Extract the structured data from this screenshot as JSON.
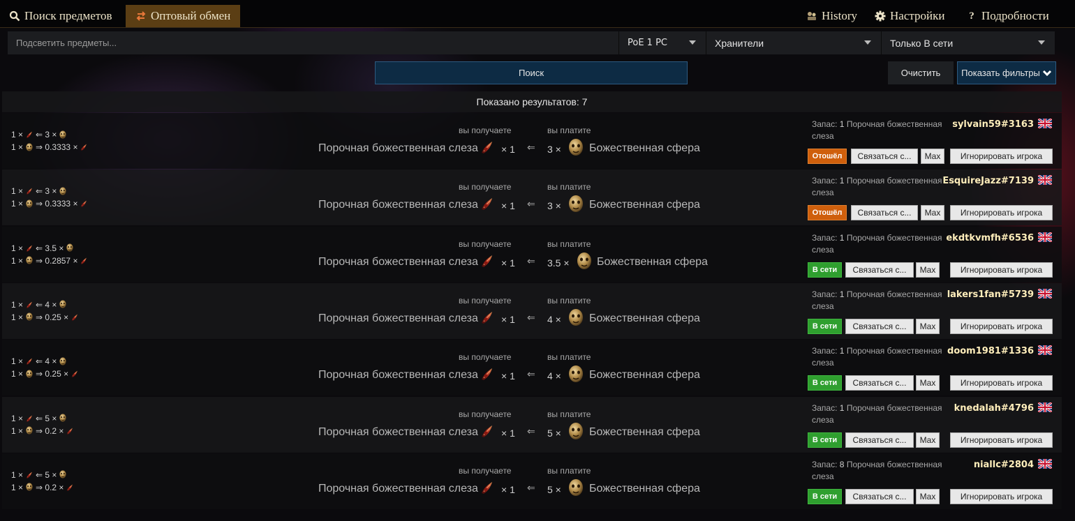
{
  "nav": {
    "search_items": "Поиск предметов",
    "bulk_exchange": "Оптовый обмен",
    "history": "History",
    "settings": "Настройки",
    "about": "Подробности"
  },
  "filters": {
    "highlight_placeholder": "Подсветить предметы...",
    "league": "PoE 1 PC",
    "league_mode": "Хранители",
    "status": "Только В сети"
  },
  "buttons": {
    "search": "Поиск",
    "clear": "Очистить",
    "show_filters": "Показать фильтры"
  },
  "results_label": "Показано результатов:",
  "results_count": "7",
  "labels": {
    "you_get": "вы получаете",
    "you_pay": "вы платите",
    "get_item": "Порочная божественная слеза",
    "pay_item": "Божественная сфера",
    "stock_prefix": "Запас:",
    "contact": "Связаться с...",
    "max": "Max",
    "ignore": "Игнорировать игрока"
  },
  "rows": [
    {
      "ratio1": "1 × ",
      "ratio1b": " ⇐ 3 × ",
      "ratio2": "1 × ",
      "ratio2b": " ⇒ 0.3333 × ",
      "get_qty": "× 1",
      "pay_qty": "3 ×",
      "stock": "1",
      "account": "sylvain59#3163",
      "status": "Отошёл",
      "online": false
    },
    {
      "ratio1": "1 × ",
      "ratio1b": " ⇐ 3 × ",
      "ratio2": "1 × ",
      "ratio2b": " ⇒ 0.3333 × ",
      "get_qty": "× 1",
      "pay_qty": "3 ×",
      "stock": "1",
      "account": "EsquireJazz#7139",
      "status": "Отошёл",
      "online": false
    },
    {
      "ratio1": "1 × ",
      "ratio1b": " ⇐ 3.5 × ",
      "ratio2": "1 × ",
      "ratio2b": " ⇒ 0.2857 × ",
      "get_qty": "× 1",
      "pay_qty": "3.5 ×",
      "stock": "1",
      "account": "ekdtkvmfh#6536",
      "status": "В сети",
      "online": true
    },
    {
      "ratio1": "1 × ",
      "ratio1b": " ⇐ 4 × ",
      "ratio2": "1 × ",
      "ratio2b": " ⇒ 0.25 × ",
      "get_qty": "× 1",
      "pay_qty": "4 ×",
      "stock": "1",
      "account": "lakers1fan#5739",
      "status": "В сети",
      "online": true
    },
    {
      "ratio1": "1 × ",
      "ratio1b": " ⇐ 4 × ",
      "ratio2": "1 × ",
      "ratio2b": " ⇒ 0.25 × ",
      "get_qty": "× 1",
      "pay_qty": "4 ×",
      "stock": "1",
      "account": "doom1981#1336",
      "status": "В сети",
      "online": true
    },
    {
      "ratio1": "1 × ",
      "ratio1b": " ⇐ 5 × ",
      "ratio2": "1 × ",
      "ratio2b": " ⇒ 0.2 × ",
      "get_qty": "× 1",
      "pay_qty": "5 ×",
      "stock": "1",
      "account": "knedalah#4796",
      "status": "В сети",
      "online": true
    },
    {
      "ratio1": "1 × ",
      "ratio1b": " ⇐ 5 × ",
      "ratio2": "1 × ",
      "ratio2b": " ⇒ 0.2 × ",
      "get_qty": "× 1",
      "pay_qty": "5 ×",
      "stock": "8",
      "account": "niallc#2804",
      "status": "В сети",
      "online": true
    }
  ]
}
